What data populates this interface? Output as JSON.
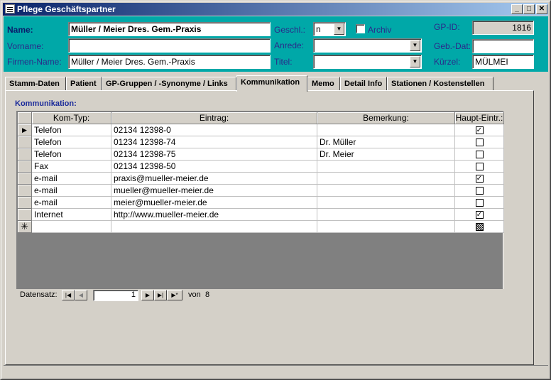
{
  "window": {
    "title": "Pflege Geschäftspartner"
  },
  "form": {
    "name_label": "Name:",
    "name_value": "Müller / Meier Dres. Gem.-Praxis",
    "vorname_label": "Vorname:",
    "vorname_value": "",
    "firmenname_label": "Firmen-Name:",
    "firmenname_value": "Müller / Meier Dres. Gem.-Praxis",
    "geschl_label": "Geschl.:",
    "geschl_value": "n",
    "archiv_label": "Archiv",
    "anrede_label": "Anrede:",
    "anrede_value": "",
    "titel_label": "Titel:",
    "titel_value": "",
    "gpid_label": "GP-ID:",
    "gpid_value": "1816",
    "gebdat_label": "Geb.-Dat:",
    "gebdat_value": "",
    "kuerzel_label": "Kürzel:",
    "kuerzel_value": "MÜLMEI"
  },
  "tabs": [
    {
      "label": "Stamm-Daten"
    },
    {
      "label": "Patient"
    },
    {
      "label": "GP-Gruppen / -Synonyme / Links"
    },
    {
      "label": "Kommunikation"
    },
    {
      "label": "Memo"
    },
    {
      "label": "Detail Info"
    },
    {
      "label": "Stationen / Kostenstellen"
    }
  ],
  "kommunikation": {
    "section_label": "Kommunikation:",
    "columns": {
      "typ": "Kom-Typ:",
      "eintrag": "Eintrag:",
      "bemerkung": "Bemerkung:",
      "haupt": "Haupt-Eintr.:"
    },
    "rows": [
      {
        "typ": "Telefon",
        "eintrag": "02134 12398-0",
        "bemerkung": "",
        "haupt": true
      },
      {
        "typ": "Telefon",
        "eintrag": "01234 12398-74",
        "bemerkung": "Dr. Müller",
        "haupt": false
      },
      {
        "typ": "Telefon",
        "eintrag": "02134 12398-75",
        "bemerkung": "Dr. Meier",
        "haupt": false
      },
      {
        "typ": "Fax",
        "eintrag": "02134 12398-50",
        "bemerkung": "",
        "haupt": false
      },
      {
        "typ": "e-mail",
        "eintrag": "praxis@mueller-meier.de",
        "bemerkung": "",
        "haupt": true
      },
      {
        "typ": "e-mail",
        "eintrag": "mueller@mueller-meier.de",
        "bemerkung": "",
        "haupt": false
      },
      {
        "typ": "e-mail",
        "eintrag": "meier@mueller-meier.de",
        "bemerkung": "",
        "haupt": false
      },
      {
        "typ": "Internet",
        "eintrag": "http://www.mueller-meier.de",
        "bemerkung": "",
        "haupt": true
      }
    ]
  },
  "navigation": {
    "label": "Datensatz:",
    "current": "1",
    "of_label": "von",
    "total": "8"
  }
}
